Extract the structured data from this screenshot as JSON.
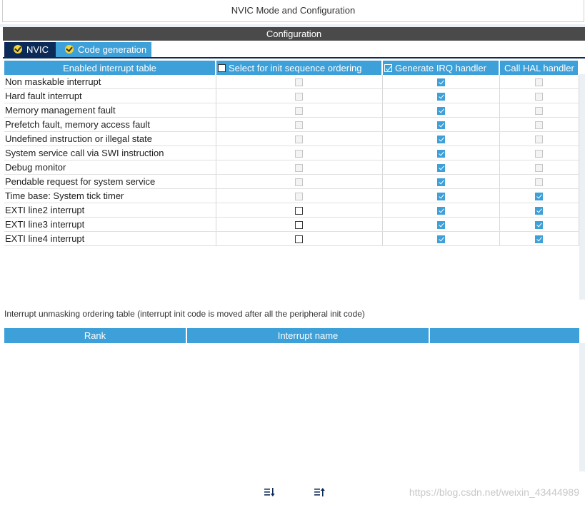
{
  "window": {
    "title": "NVIC Mode and Configuration"
  },
  "config_header": "Configuration",
  "tabs": [
    {
      "label": "NVIC",
      "active": true
    },
    {
      "label": "Code generation",
      "active": false
    }
  ],
  "nvic_table": {
    "headers": {
      "col0": "Enabled interrupt table",
      "col1": "Select for init sequence ordering",
      "col2": "Generate IRQ handler",
      "col3": "Call HAL handler"
    },
    "header_checkbox_states": {
      "col1": false,
      "col2": true
    },
    "rows": [
      {
        "name": "Non maskable interrupt",
        "init_order": "disabled",
        "irq": true,
        "hal": "disabled"
      },
      {
        "name": "Hard fault interrupt",
        "init_order": "disabled",
        "irq": true,
        "hal": "disabled"
      },
      {
        "name": "Memory management fault",
        "init_order": "disabled",
        "irq": true,
        "hal": "disabled"
      },
      {
        "name": "Prefetch fault, memory access fault",
        "init_order": "disabled",
        "irq": true,
        "hal": "disabled"
      },
      {
        "name": "Undefined instruction or illegal state",
        "init_order": "disabled",
        "irq": true,
        "hal": "disabled"
      },
      {
        "name": "System service call via SWI instruction",
        "init_order": "disabled",
        "irq": true,
        "hal": "disabled"
      },
      {
        "name": "Debug monitor",
        "init_order": "disabled",
        "irq": true,
        "hal": "disabled"
      },
      {
        "name": "Pendable request for system service",
        "init_order": "disabled",
        "irq": true,
        "hal": "disabled"
      },
      {
        "name": "Time base: System tick timer",
        "init_order": "disabled",
        "irq": true,
        "hal": true
      },
      {
        "name": "EXTI line2 interrupt",
        "init_order": "enabled",
        "irq": true,
        "hal": true
      },
      {
        "name": "EXTI line3 interrupt",
        "init_order": "enabled",
        "irq": true,
        "hal": true
      },
      {
        "name": "EXTI line4 interrupt",
        "init_order": "enabled",
        "irq": true,
        "hal": true
      }
    ]
  },
  "unmask_label": "Interrupt unmasking ordering table (interrupt init code is moved after all the peripheral init code)",
  "order_table": {
    "headers": {
      "rank": "Rank",
      "name": "Interrupt name"
    }
  },
  "footer": {
    "sort_down_icon": "sort-down-icon",
    "sort_up_icon": "sort-up-icon"
  },
  "watermark": "https://blog.csdn.net/weixin_43444989",
  "colors": {
    "accent": "#3ea0d8",
    "dark_tab": "#0c2a57",
    "header_bar": "#4a4a4a"
  }
}
